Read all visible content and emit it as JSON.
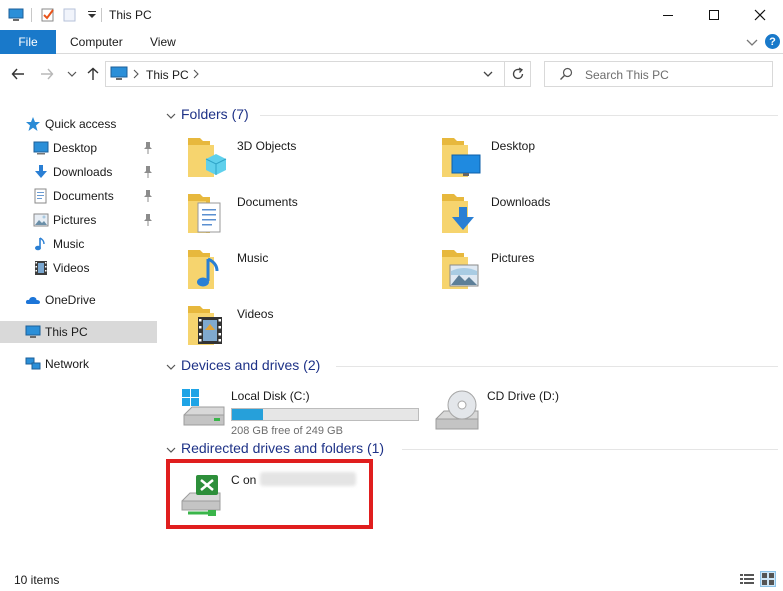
{
  "window": {
    "title": "This PC"
  },
  "ribbon": {
    "file_label": "File",
    "tabs": [
      "Computer",
      "View"
    ],
    "help_label": "?"
  },
  "address": {
    "path": "This PC"
  },
  "search": {
    "placeholder": "Search This PC"
  },
  "sidebar": {
    "quick_access": "Quick access",
    "items": [
      {
        "label": "Desktop",
        "icon": "desktop-icon",
        "pinned": true
      },
      {
        "label": "Downloads",
        "icon": "downloads-icon",
        "pinned": true
      },
      {
        "label": "Documents",
        "icon": "documents-icon",
        "pinned": true
      },
      {
        "label": "Pictures",
        "icon": "pictures-icon",
        "pinned": true
      },
      {
        "label": "Music",
        "icon": "music-icon",
        "pinned": false
      },
      {
        "label": "Videos",
        "icon": "videos-icon",
        "pinned": false
      }
    ],
    "onedrive": "OneDrive",
    "this_pc": "This PC",
    "network": "Network"
  },
  "groups": {
    "folders": {
      "header": "Folders (7)",
      "items": [
        "3D Objects",
        "Desktop",
        "Documents",
        "Downloads",
        "Music",
        "Pictures",
        "Videos"
      ]
    },
    "devices": {
      "header": "Devices and drives (2)",
      "local_disk": {
        "name": "Local Disk (C:)",
        "free_text": "208 GB free of 249 GB",
        "used_fraction": 0.165
      },
      "cd_drive": {
        "name": "CD Drive (D:)"
      }
    },
    "redirected": {
      "header": "Redirected drives and folders (1)",
      "item": {
        "name": "C on"
      }
    }
  },
  "status": {
    "item_count": "10 items"
  },
  "colors": {
    "accent": "#1979ca",
    "header_text": "#1e3287",
    "highlight": "#e01e1e",
    "drive_bar": "#26a0da",
    "selected_bg": "#d9d9d9"
  }
}
